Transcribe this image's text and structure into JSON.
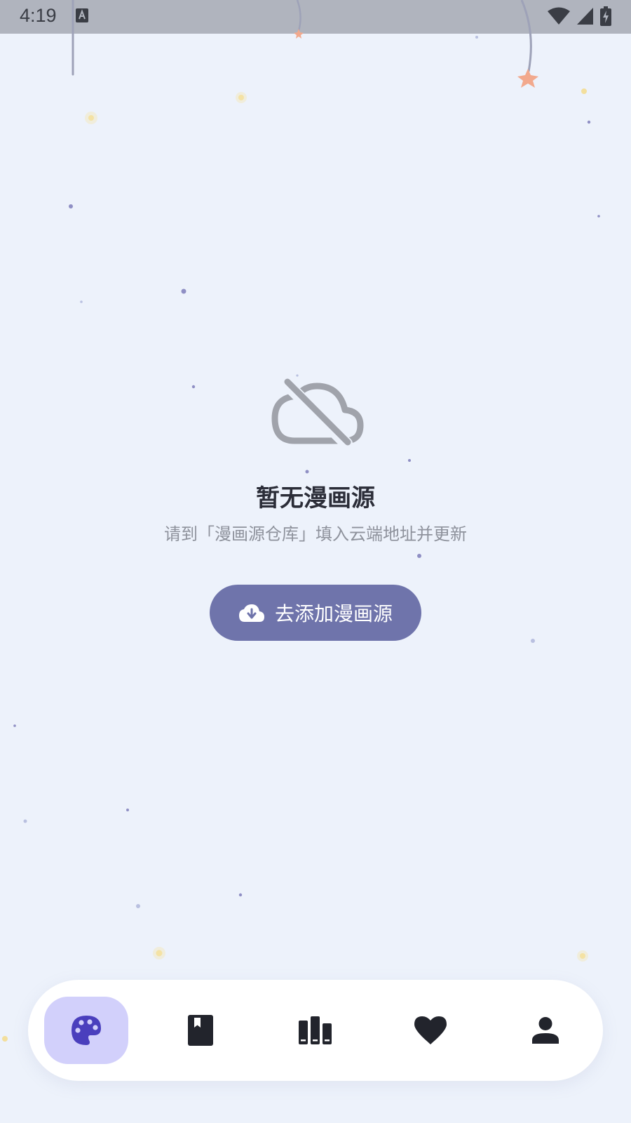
{
  "status_bar": {
    "time": "4:19",
    "icons": [
      "text-input-notification-icon",
      "wifi-icon",
      "cellular-signal-icon",
      "battery-charging-icon"
    ]
  },
  "empty_state": {
    "icon": "cloud-off-icon",
    "title": "暂无漫画源",
    "subtitle": "请到「漫画源仓库」填入云端地址并更新"
  },
  "add_source_button": {
    "icon": "cloud-download-icon",
    "label": "去添加漫画源"
  },
  "bottom_nav": {
    "active_index": 0,
    "items": [
      {
        "icon": "palette-icon"
      },
      {
        "icon": "bookmark-book-icon"
      },
      {
        "icon": "library-books-icon"
      },
      {
        "icon": "heart-icon"
      },
      {
        "icon": "person-icon"
      }
    ]
  },
  "colors": {
    "background": "#edf2fb",
    "status_bar": "#b0b4be",
    "accent_button": "#6f74ab",
    "nav_active": "#d2d0fb",
    "nav_active_icon": "#4a3fbd",
    "nav_icon": "#22242c",
    "title_text": "#2b2d38",
    "subtitle_text": "#8e929c",
    "empty_icon": "#a0a3ab"
  }
}
